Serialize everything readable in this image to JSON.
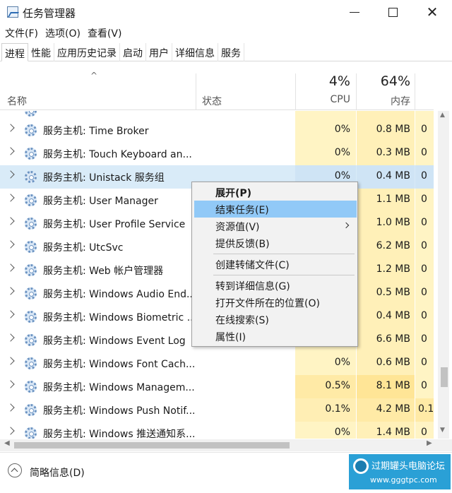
{
  "window": {
    "title": "任务管理器",
    "controls": {
      "minimize": "",
      "maximize": "",
      "close": "✕"
    }
  },
  "menu": [
    "文件(F)",
    "选项(O)",
    "查看(V)"
  ],
  "tabs": [
    "进程",
    "性能",
    "应用历史记录",
    "启动",
    "用户",
    "详细信息",
    "服务"
  ],
  "active_tab": 0,
  "columns": {
    "sort_indicator": "^",
    "name": "名称",
    "status": "状态",
    "cpu_percent": "4%",
    "cpu_label": "CPU",
    "mem_percent": "64%",
    "mem_label": "内存"
  },
  "rows": [
    {
      "name": "服务主机: Time Broker",
      "cpu": "0%",
      "mem": "0.8 MB",
      "next": "0"
    },
    {
      "name": "服务主机: Touch Keyboard an...",
      "cpu": "0%",
      "mem": "0.3 MB",
      "next": "0"
    },
    {
      "name": "服务主机: Unistack 服务组",
      "cpu": "0%",
      "mem": "0.4 MB",
      "next": "0"
    },
    {
      "name": "服务主机: User Manager",
      "cpu": "",
      "mem": "1.1 MB",
      "next": "0"
    },
    {
      "name": "服务主机: User Profile Service",
      "cpu": "",
      "mem": "1.0 MB",
      "next": "0"
    },
    {
      "name": "服务主机: UtcSvc",
      "cpu": "",
      "mem": "6.2 MB",
      "next": "0"
    },
    {
      "name": "服务主机: Web 帐户管理器",
      "cpu": "",
      "mem": "1.2 MB",
      "next": "0"
    },
    {
      "name": "服务主机: Windows Audio End...",
      "cpu": "",
      "mem": "0.5 MB",
      "next": "0"
    },
    {
      "name": "服务主机: Windows Biometric ...",
      "cpu": "",
      "mem": "0.4 MB",
      "next": "0"
    },
    {
      "name": "服务主机: Windows Event Log",
      "cpu": "",
      "mem": "6.6 MB",
      "next": "0"
    },
    {
      "name": "服务主机: Windows Font Cach...",
      "cpu": "0%",
      "mem": "0.6 MB",
      "next": "0"
    },
    {
      "name": "服务主机: Windows Managem...",
      "cpu": "0.5%",
      "mem": "8.1 MB",
      "next": "0"
    },
    {
      "name": "服务主机: Windows Push Notif...",
      "cpu": "0.1%",
      "mem": "4.2 MB",
      "next": "0.1"
    },
    {
      "name": "服务主机: Windows 推送通知系...",
      "cpu": "0%",
      "mem": "1.4 MB",
      "next": "0"
    }
  ],
  "selected_row": 2,
  "context_menu": {
    "items": [
      {
        "label": "展开(P)",
        "bold": true
      },
      {
        "label": "结束任务(E)",
        "highlighted": true
      },
      {
        "label": "资源值(V)",
        "submenu": true
      },
      {
        "label": "提供反馈(B)"
      },
      {
        "label": "创建转储文件(C)"
      },
      {
        "label": "转到详细信息(G)"
      },
      {
        "label": "打开文件所在的位置(O)"
      },
      {
        "label": "在线搜索(S)"
      },
      {
        "label": "属性(I)"
      }
    ]
  },
  "footer": {
    "fewer_details": "简略信息(D)"
  },
  "watermark": {
    "title": "过期罐头电脑论坛",
    "url": "www.gggtpc.com"
  },
  "colors": {
    "selected_row": "#d9ebf8",
    "cpu_heat": "#fff4c4",
    "menu_highlight": "#91c9f7"
  }
}
